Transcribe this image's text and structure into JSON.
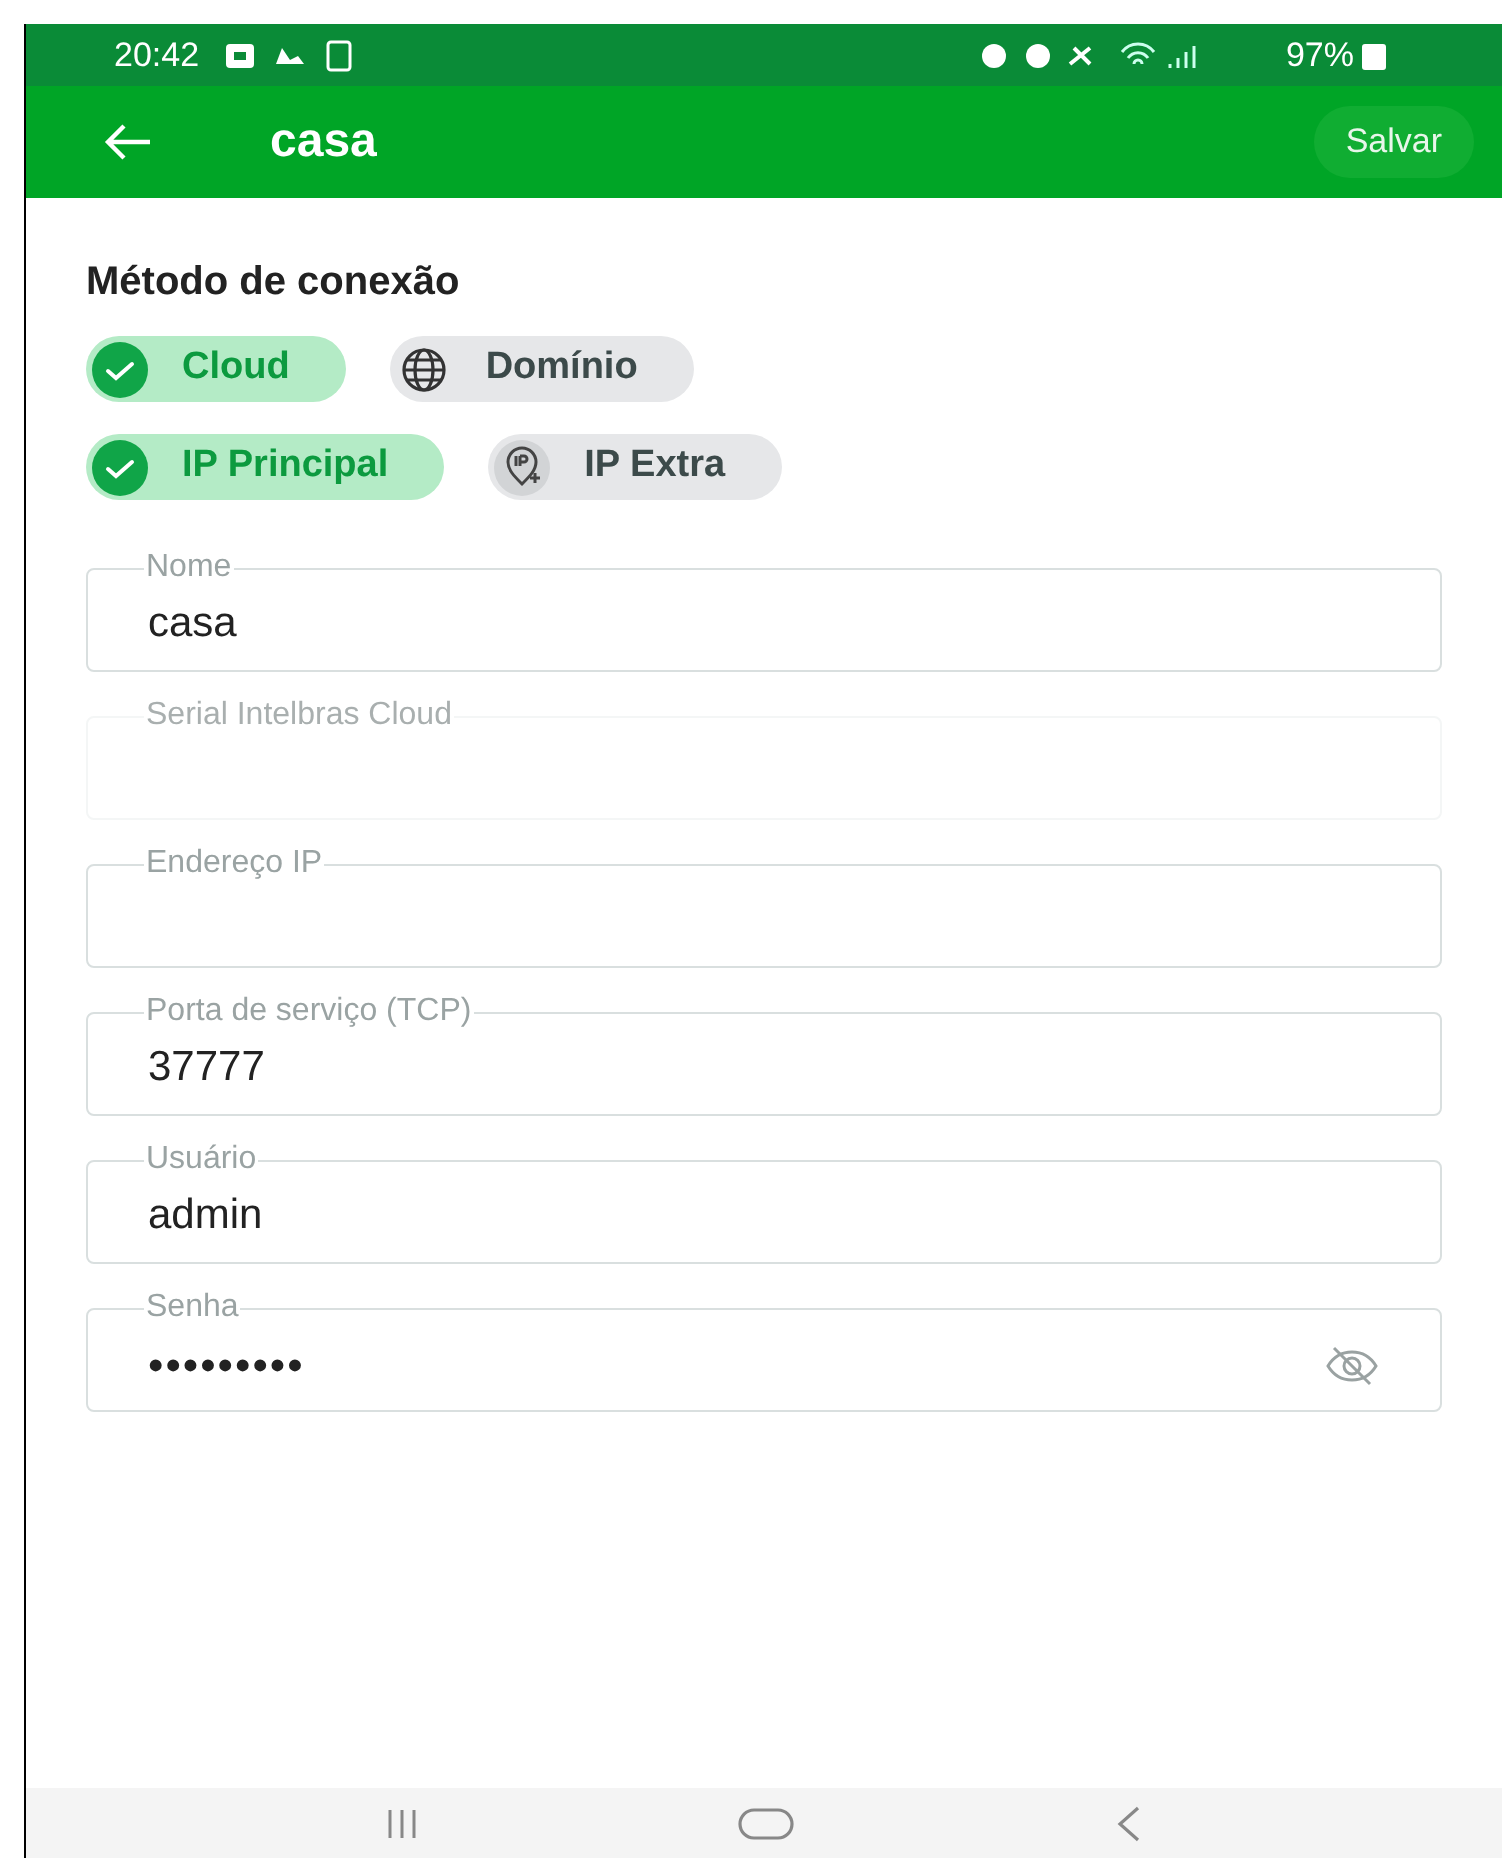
{
  "status_bar": {
    "time": "20:42",
    "battery": "97%"
  },
  "app_bar": {
    "title": "casa",
    "action": "Salvar"
  },
  "section_title": "Método de conexão",
  "chip_rows": [
    [
      {
        "label": "Cloud",
        "selected": true
      },
      {
        "label": "Domínio",
        "kind": "globe",
        "selected": false
      }
    ],
    [
      {
        "label": "IP Principal",
        "selected": true
      },
      {
        "label": "IP Extra",
        "kind": "ip",
        "selected": false
      }
    ]
  ],
  "fields": [
    {
      "label": "Nome",
      "value": "casa",
      "disabled": false,
      "kind": "text"
    },
    {
      "label": "Serial Intelbras Cloud",
      "disabled": true,
      "kind": "text"
    },
    {
      "label": "Endereço IP",
      "disabled": false,
      "kind": "text"
    },
    {
      "label": "Porta de serviço (TCP)",
      "value": "37777",
      "disabled": false,
      "kind": "text"
    },
    {
      "label": "Usuário",
      "value": "admin",
      "disabled": false,
      "kind": "text"
    },
    {
      "label": "Senha",
      "value": "•••••••••",
      "disabled": false,
      "kind": "password"
    }
  ]
}
